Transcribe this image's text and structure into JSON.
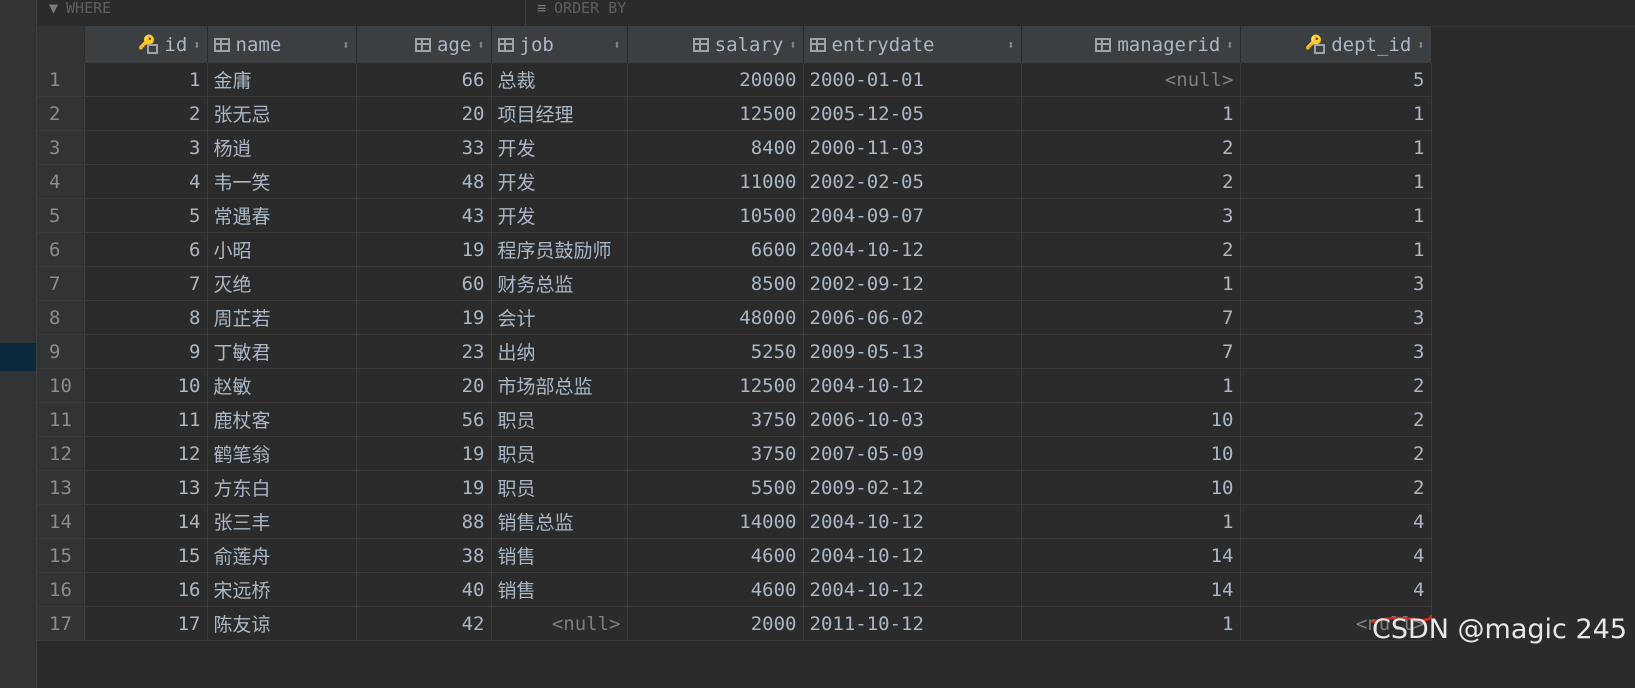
{
  "filter": {
    "where_label": "WHERE",
    "order_label": "ORDER BY"
  },
  "columns": [
    "id",
    "name",
    "age",
    "job",
    "salary",
    "entrydate",
    "managerid",
    "dept_id"
  ],
  "rows": [
    {
      "n": "1",
      "id": "1",
      "name": "金庸",
      "age": "66",
      "job": "总裁",
      "salary": "20000",
      "entrydate": "2000-01-01",
      "managerid": "<null>",
      "dept_id": "5"
    },
    {
      "n": "2",
      "id": "2",
      "name": "张无忌",
      "age": "20",
      "job": "项目经理",
      "salary": "12500",
      "entrydate": "2005-12-05",
      "managerid": "1",
      "dept_id": "1"
    },
    {
      "n": "3",
      "id": "3",
      "name": "杨逍",
      "age": "33",
      "job": "开发",
      "salary": "8400",
      "entrydate": "2000-11-03",
      "managerid": "2",
      "dept_id": "1"
    },
    {
      "n": "4",
      "id": "4",
      "name": "韦一笑",
      "age": "48",
      "job": "开发",
      "salary": "11000",
      "entrydate": "2002-02-05",
      "managerid": "2",
      "dept_id": "1"
    },
    {
      "n": "5",
      "id": "5",
      "name": "常遇春",
      "age": "43",
      "job": "开发",
      "salary": "10500",
      "entrydate": "2004-09-07",
      "managerid": "3",
      "dept_id": "1"
    },
    {
      "n": "6",
      "id": "6",
      "name": "小昭",
      "age": "19",
      "job": "程序员鼓励师",
      "salary": "6600",
      "entrydate": "2004-10-12",
      "managerid": "2",
      "dept_id": "1"
    },
    {
      "n": "7",
      "id": "7",
      "name": "灭绝",
      "age": "60",
      "job": "财务总监",
      "salary": "8500",
      "entrydate": "2002-09-12",
      "managerid": "1",
      "dept_id": "3"
    },
    {
      "n": "8",
      "id": "8",
      "name": "周芷若",
      "age": "19",
      "job": "会计",
      "salary": "48000",
      "entrydate": "2006-06-02",
      "managerid": "7",
      "dept_id": "3"
    },
    {
      "n": "9",
      "id": "9",
      "name": "丁敏君",
      "age": "23",
      "job": "出纳",
      "salary": "5250",
      "entrydate": "2009-05-13",
      "managerid": "7",
      "dept_id": "3"
    },
    {
      "n": "10",
      "id": "10",
      "name": "赵敏",
      "age": "20",
      "job": "市场部总监",
      "salary": "12500",
      "entrydate": "2004-10-12",
      "managerid": "1",
      "dept_id": "2"
    },
    {
      "n": "11",
      "id": "11",
      "name": "鹿杖客",
      "age": "56",
      "job": "职员",
      "salary": "3750",
      "entrydate": "2006-10-03",
      "managerid": "10",
      "dept_id": "2"
    },
    {
      "n": "12",
      "id": "12",
      "name": "鹤笔翁",
      "age": "19",
      "job": "职员",
      "salary": "3750",
      "entrydate": "2007-05-09",
      "managerid": "10",
      "dept_id": "2"
    },
    {
      "n": "13",
      "id": "13",
      "name": "方东白",
      "age": "19",
      "job": "职员",
      "salary": "5500",
      "entrydate": "2009-02-12",
      "managerid": "10",
      "dept_id": "2"
    },
    {
      "n": "14",
      "id": "14",
      "name": "张三丰",
      "age": "88",
      "job": "销售总监",
      "salary": "14000",
      "entrydate": "2004-10-12",
      "managerid": "1",
      "dept_id": "4"
    },
    {
      "n": "15",
      "id": "15",
      "name": "俞莲舟",
      "age": "38",
      "job": "销售",
      "salary": "4600",
      "entrydate": "2004-10-12",
      "managerid": "14",
      "dept_id": "4"
    },
    {
      "n": "16",
      "id": "16",
      "name": "宋远桥",
      "age": "40",
      "job": "销售",
      "salary": "4600",
      "entrydate": "2004-10-12",
      "managerid": "14",
      "dept_id": "4"
    },
    {
      "n": "17",
      "id": "17",
      "name": "陈友谅",
      "age": "42",
      "job": "<null>",
      "salary": "2000",
      "entrydate": "2011-10-12",
      "managerid": "1",
      "dept_id": "<null>"
    }
  ],
  "watermark": "CSDN @magic 245"
}
